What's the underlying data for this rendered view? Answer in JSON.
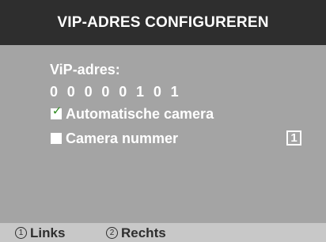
{
  "header": {
    "title": "VIP-ADRES CONFIGUREREN"
  },
  "main": {
    "address_label": "ViP-adres:",
    "address_value": "0 0 0 0 0 1 0 1",
    "options": [
      {
        "label": "Automatische camera",
        "checked": true,
        "check_glyph": "✓"
      },
      {
        "label": "Camera nummer",
        "checked": false,
        "value": "1"
      }
    ]
  },
  "footer": {
    "left": {
      "key": "1",
      "label": "Links"
    },
    "right": {
      "key": "2",
      "label": "Rechts"
    }
  },
  "colors": {
    "title_bar": "#2e2e2e",
    "panel": "#a4a4a4",
    "footer_bar": "#c8c8c8",
    "text": "#ffffff",
    "check": "#2d8a1e"
  }
}
